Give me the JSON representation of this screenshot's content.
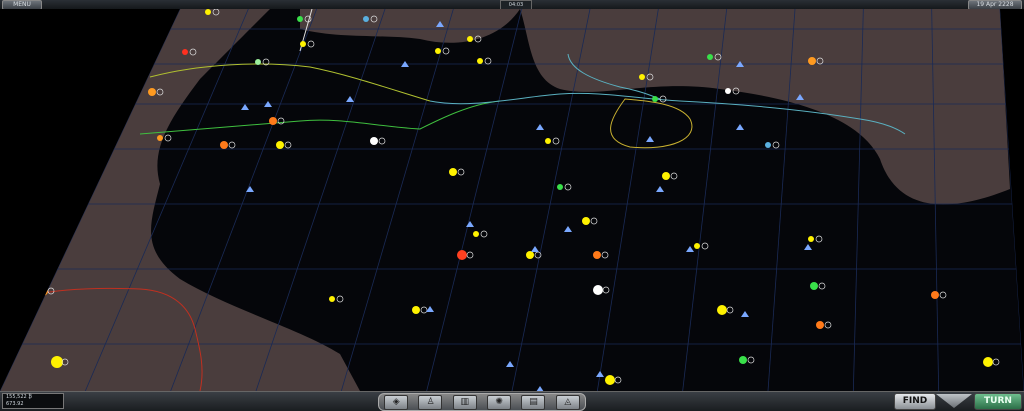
{
  "topbar": {
    "menu_label": "MENU",
    "date": "19 Apr 2228",
    "center": "04:03"
  },
  "bottombar": {
    "money_line1": "155,522 ₿",
    "money_line2": "673.92",
    "find_label": "FIND",
    "turn_label": "TURN",
    "tools": [
      "◈",
      "♙",
      "▥",
      "✺",
      "▤",
      "◬"
    ]
  },
  "colors": {
    "nebula": "#4a3d3d",
    "grid": "#1a2a55",
    "yellow_star": "#fff200",
    "orange_star": "#ff7a1a",
    "green_star": "#39e04a"
  }
}
